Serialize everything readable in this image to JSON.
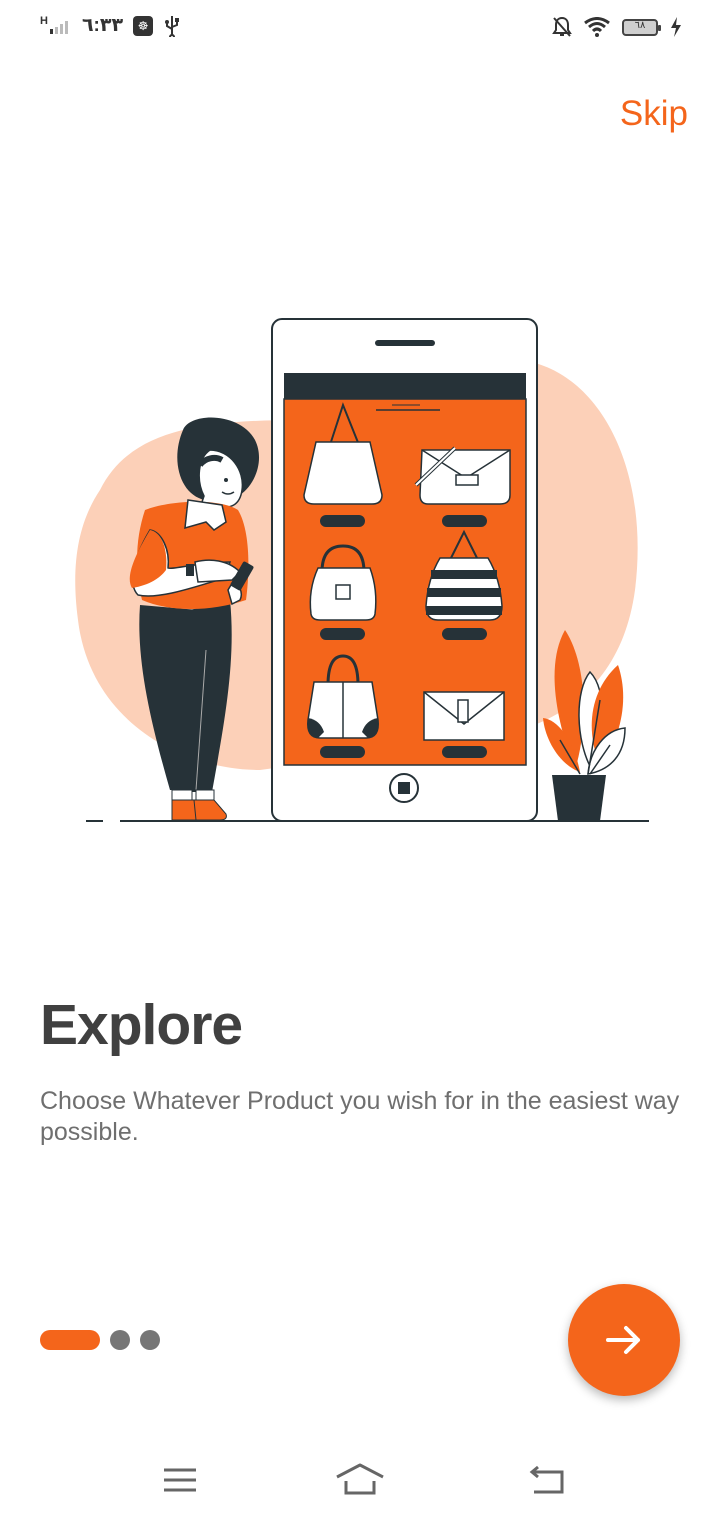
{
  "status_bar": {
    "network": "H",
    "time": "٦:٣٣",
    "battery": "٦٨"
  },
  "skip_label": "Skip",
  "onboarding": {
    "title": "Explore",
    "description": "Choose Whatever Product you wish for in the easiest way possible.",
    "page_count": 3,
    "current_page": 1
  },
  "colors": {
    "accent": "#f4651b",
    "blob": "#fcd0b8",
    "dark": "#263238",
    "title": "#404040",
    "body_text": "#6f6f6f",
    "inactive_dot": "#767676"
  },
  "icons": {
    "next": "arrow-right-icon",
    "nav_menu": "menu-icon",
    "nav_home": "home-icon",
    "nav_back": "back-icon"
  }
}
